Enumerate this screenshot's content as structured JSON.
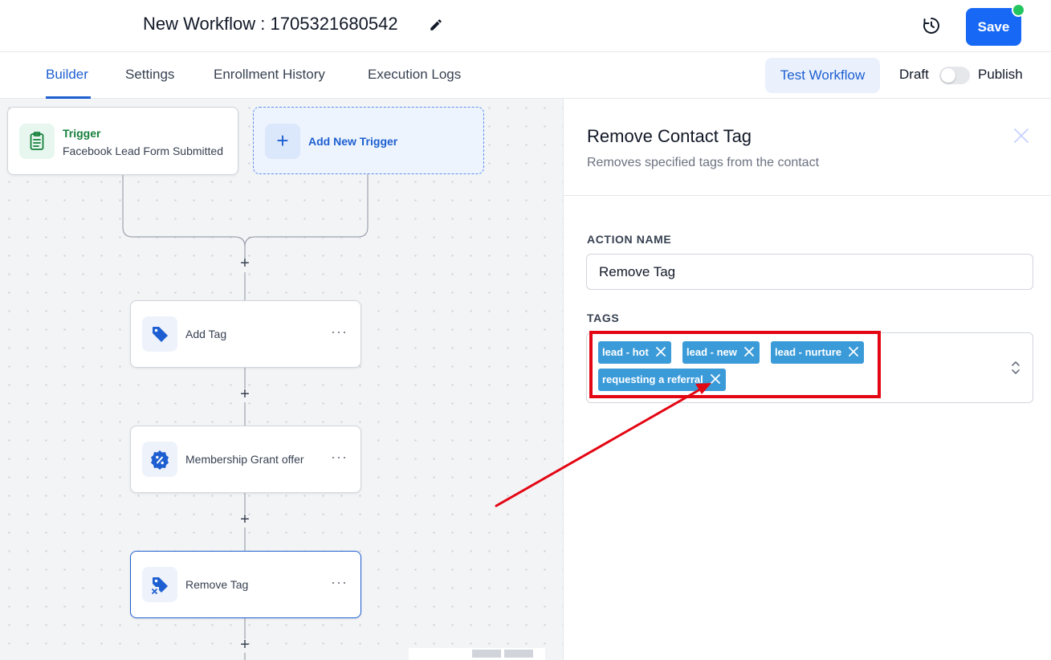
{
  "header": {
    "workflow_title": "New Workflow : 1705321680542",
    "save_label": "Save"
  },
  "tabs": [
    {
      "label": "Builder",
      "active": true
    },
    {
      "label": "Settings",
      "active": false
    },
    {
      "label": "Enrollment History",
      "active": false
    },
    {
      "label": "Execution Logs",
      "active": false
    }
  ],
  "toolbar": {
    "test_workflow_label": "Test Workflow",
    "draft_label": "Draft",
    "publish_label": "Publish",
    "published": false
  },
  "canvas": {
    "trigger": {
      "label": "Trigger",
      "name": "Facebook Lead Form Submitted",
      "icon": "clipboard-list-icon"
    },
    "add_trigger_label": "Add New Trigger",
    "nodes": [
      {
        "label": "Add Tag",
        "icon": "tag-icon",
        "selected": false
      },
      {
        "label": "Membership Grant offer",
        "icon": "percent-badge-icon",
        "selected": false
      },
      {
        "label": "Remove Tag",
        "icon": "tag-remove-icon",
        "selected": true
      }
    ],
    "node_menu_glyph": "···",
    "add_step_glyph": "+"
  },
  "panel": {
    "title": "Remove Contact Tag",
    "subtitle": "Removes specified tags from the contact",
    "action_name_label": "ACTION NAME",
    "action_name_value": "Remove Tag",
    "tags_label": "TAGS",
    "tags": [
      "lead - hot",
      "lead - new",
      "lead - nurture",
      "requesting a referral"
    ]
  },
  "colors": {
    "primary": "#1769f5",
    "tag_chip": "#3b9bd9",
    "annotation_red": "#e30613",
    "trigger_green": "#15803d",
    "status_dot": "#22c55e"
  }
}
